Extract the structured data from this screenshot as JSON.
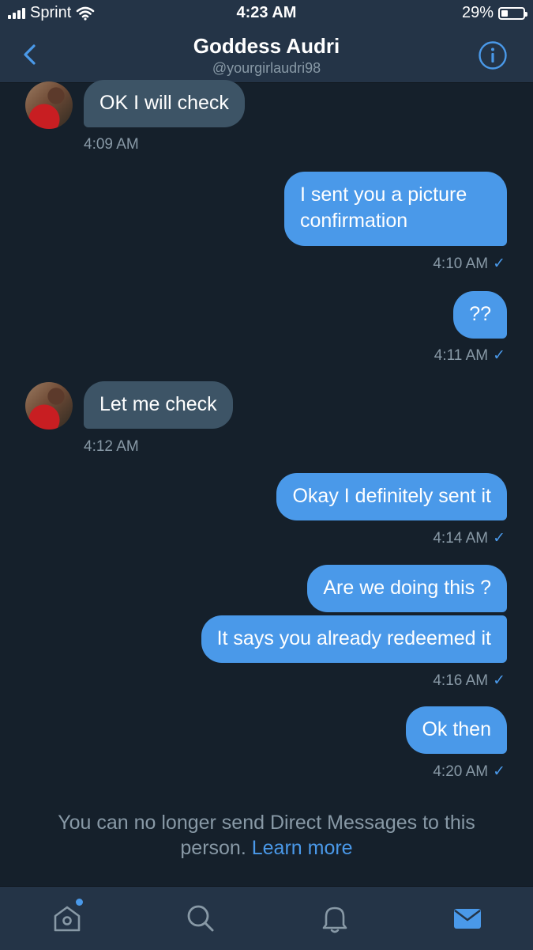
{
  "status_bar": {
    "carrier": "Sprint",
    "time": "4:23 AM",
    "battery": "29%",
    "battery_level": 0.29
  },
  "header": {
    "title": "Goddess Audri",
    "handle": "@yourgirlaudri98"
  },
  "messages": [
    {
      "direction": "in",
      "text": "OK I will check",
      "time": "4:09 AM"
    },
    {
      "direction": "out",
      "text": "I sent you a picture confirmation",
      "time": "4:10 AM",
      "status": "✓"
    },
    {
      "direction": "out",
      "text": "??",
      "time": "4:11 AM",
      "status": "✓"
    },
    {
      "direction": "in",
      "text": "Let me check",
      "time": "4:12 AM"
    },
    {
      "direction": "out",
      "text": "Okay I definitely sent it",
      "time": "4:14 AM",
      "status": "✓"
    },
    {
      "direction": "out",
      "text": "Are we doing this ?",
      "time": ""
    },
    {
      "direction": "out",
      "text": "It says you already redeemed it",
      "time": "4:16 AM",
      "status": "✓"
    },
    {
      "direction": "out",
      "text": "Ok then",
      "time": "4:20 AM",
      "status": "✓"
    }
  ],
  "notice": {
    "text": "You can no longer send Direct Messages to this person.",
    "link": "Learn more"
  },
  "tab_bar": {
    "items": [
      "home-icon",
      "search-icon",
      "bell-icon",
      "mail-icon"
    ],
    "active": "mail-icon"
  },
  "colors": {
    "background": "#15202b",
    "bar": "#243447",
    "accent": "#4a99e9",
    "incoming_bubble": "#3d5466",
    "muted_text": "#8899a6"
  }
}
